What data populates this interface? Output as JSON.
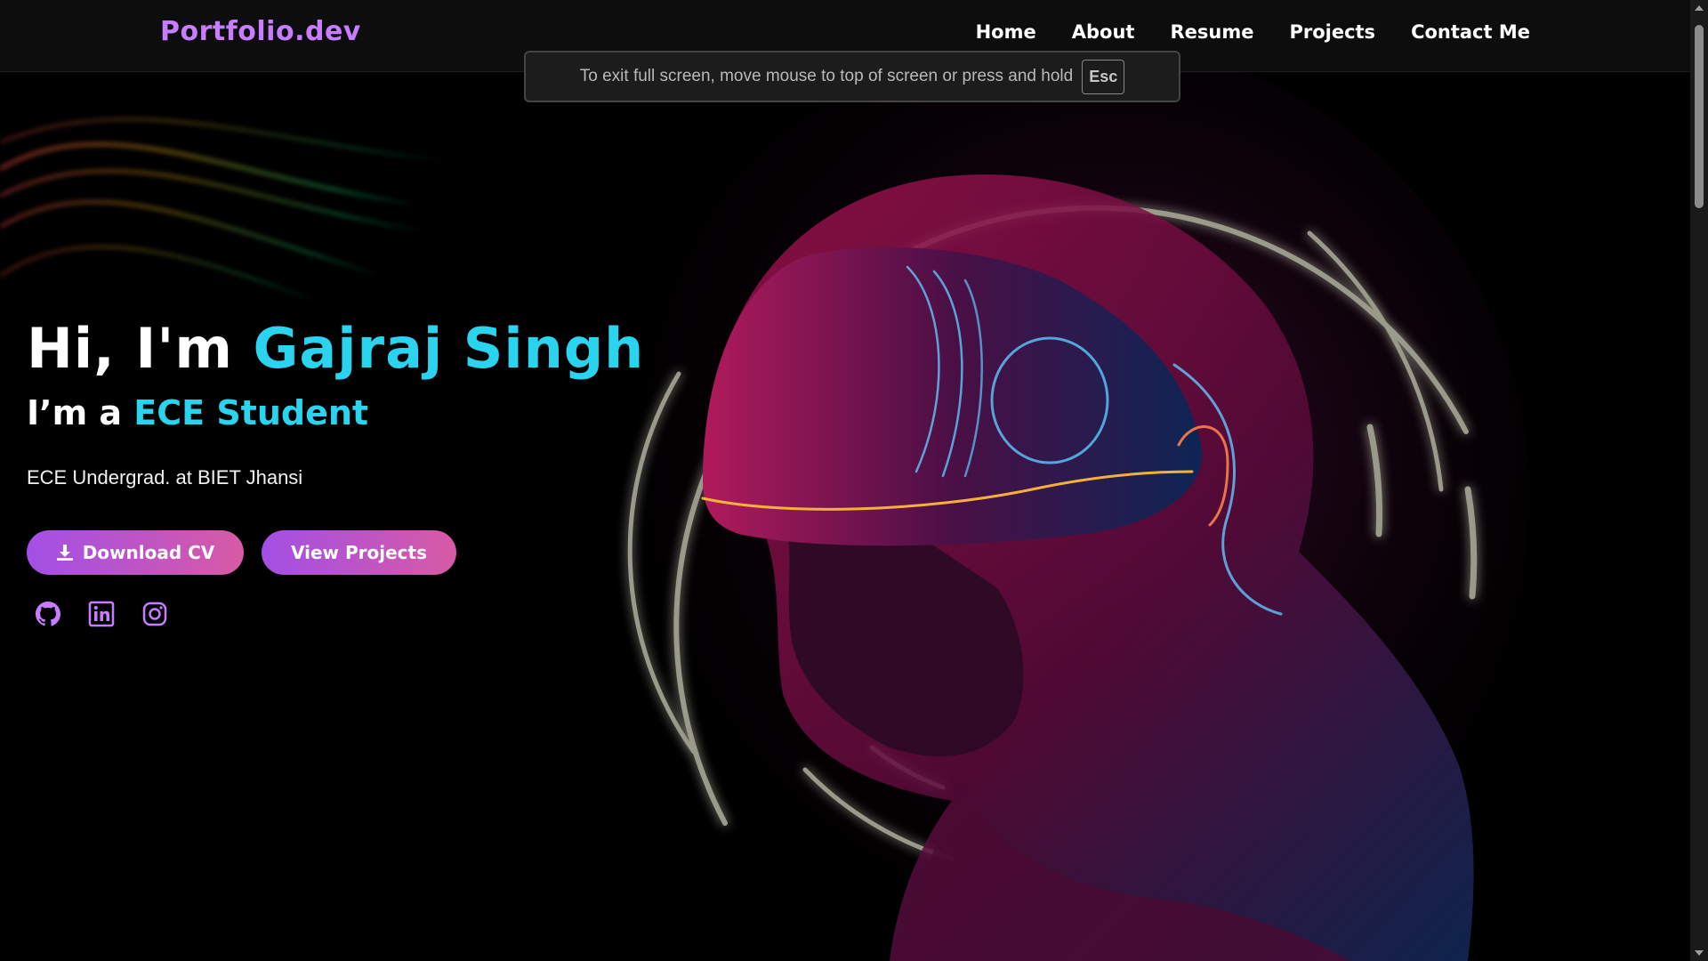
{
  "nav": {
    "logo": "Portfolio.dev",
    "links": [
      "Home",
      "About",
      "Resume",
      "Projects",
      "Contact Me"
    ]
  },
  "fullscreen_notice": {
    "text": "To exit full screen, move mouse to top of screen or press and hold",
    "key": "Esc"
  },
  "hero": {
    "greeting": "Hi, I'm ",
    "name": "Gajraj Singh",
    "role_prefix": "I’m a ",
    "role": "ECE Student",
    "description": "ECE Undergrad. at BIET Jhansi",
    "buttons": {
      "download_cv": "Download CV",
      "view_projects": "View Projects"
    },
    "social_icons": [
      "github-icon",
      "linkedin-icon",
      "instagram-icon"
    ]
  },
  "colors": {
    "logo": "#c77dff",
    "accent": "#2bd4ee",
    "button_gradient_start": "#a24fe6",
    "button_gradient_end": "#d85aa5",
    "social_icon": "#c77dff",
    "background": "#000000"
  }
}
